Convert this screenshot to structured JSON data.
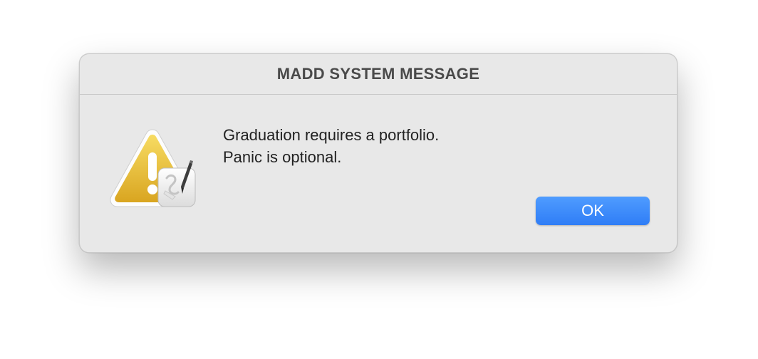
{
  "dialog": {
    "title": "MADD SYSTEM MESSAGE",
    "message_lines": [
      "Graduation requires a portfolio.",
      "Panic is optional."
    ],
    "ok_label": "OK",
    "icon": "warning-triangle-icon",
    "badge_icon": "script-editor-pen-icon"
  },
  "colors": {
    "accent_button": "#3385f9",
    "warning_yellow": "#e9c23c",
    "dialog_background": "#e8e8e8"
  }
}
